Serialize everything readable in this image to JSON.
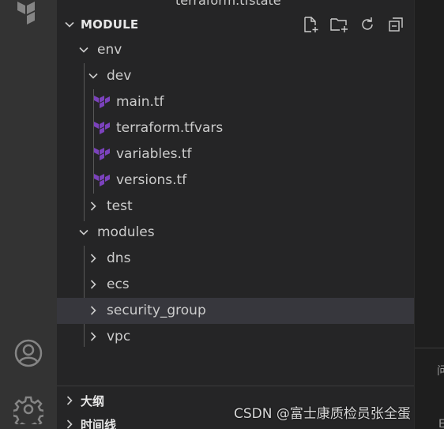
{
  "activity_bar": {
    "icons": [
      "terraform-logo-icon",
      "account-icon",
      "settings-gear-icon"
    ]
  },
  "explorer": {
    "peek_text": "terraform.tfstate",
    "section_title": "MODULE",
    "actions": [
      "new-file-icon",
      "new-folder-icon",
      "refresh-icon",
      "collapse-all-icon"
    ],
    "tree": [
      {
        "label": "env"
      },
      {
        "label": "dev"
      },
      {
        "label": "main.tf"
      },
      {
        "label": "terraform.tfvars"
      },
      {
        "label": "variables.tf"
      },
      {
        "label": "versions.tf"
      },
      {
        "label": "test"
      },
      {
        "label": "modules"
      },
      {
        "label": "dns"
      },
      {
        "label": "ecs"
      },
      {
        "label": "security_group"
      },
      {
        "label": "vpc"
      }
    ],
    "outline_label": "大纲",
    "timeline_label": "时间线"
  },
  "editor_edge": {
    "char_1": "问",
    "char_2": "E"
  },
  "watermark": "CSDN @富士康质检员张全蛋",
  "colors": {
    "terraform_purple": "#7b42bc",
    "selection": "#37373d",
    "sidebar_bg": "#252526",
    "activity_bg": "#333333"
  }
}
